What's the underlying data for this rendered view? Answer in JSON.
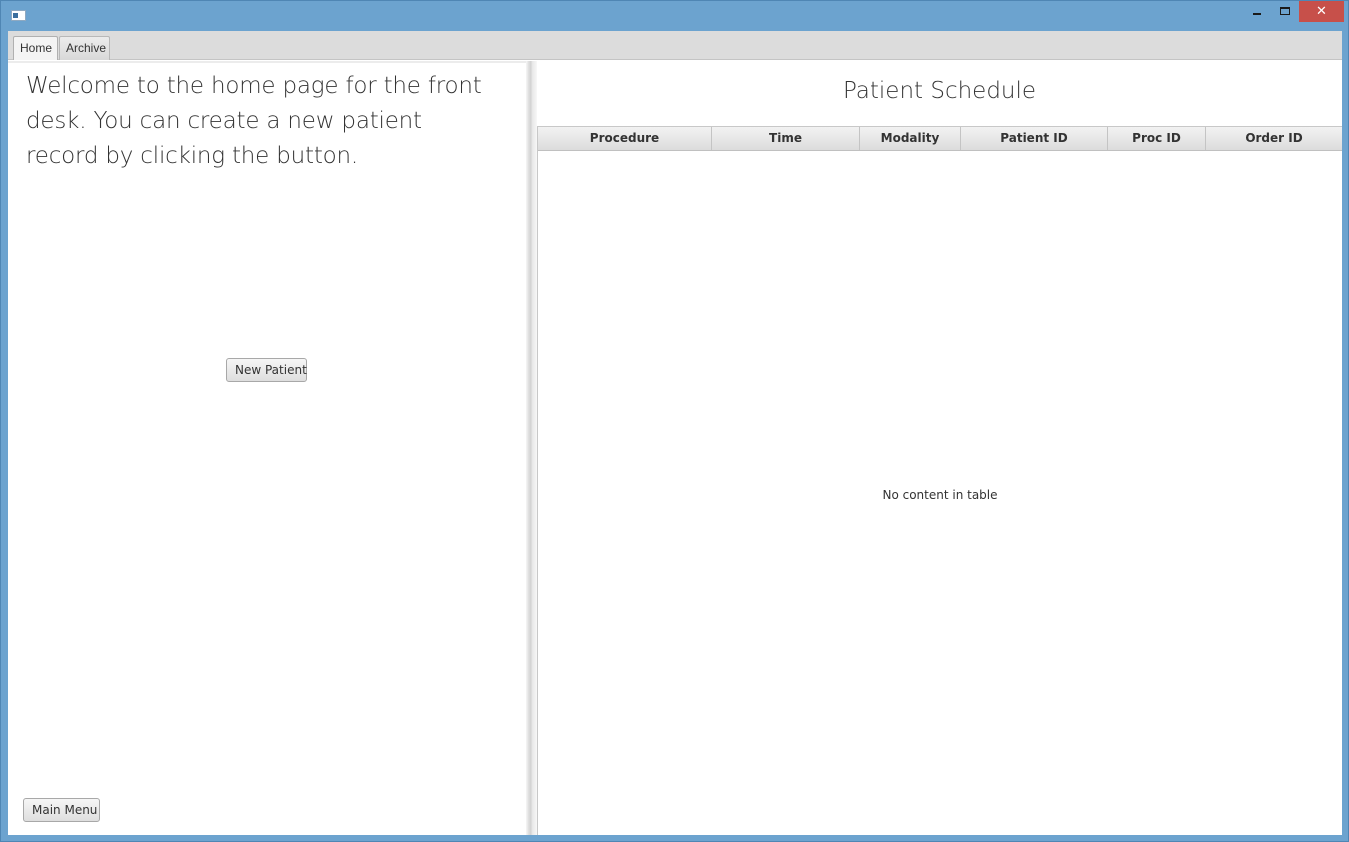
{
  "window": {
    "close_glyph": "✕"
  },
  "tabs": [
    {
      "label": "Home",
      "active": true
    },
    {
      "label": "Archive",
      "active": false
    }
  ],
  "left_pane": {
    "welcome_text": "Welcome to the home page for the front desk. You can create a new patient record by clicking the button.",
    "new_patient_label": "New Patient",
    "main_menu_label": "Main Menu"
  },
  "right_pane": {
    "title": "Patient Schedule",
    "table": {
      "columns": [
        "Procedure",
        "Time",
        "Modality",
        "Patient ID",
        "Proc ID",
        "Order ID"
      ],
      "rows": [],
      "empty_message": "No content in table"
    }
  },
  "colors": {
    "titlebar": "#6ca3cf",
    "close_button": "#c7504a",
    "tab_strip": "#dcdcdc"
  }
}
